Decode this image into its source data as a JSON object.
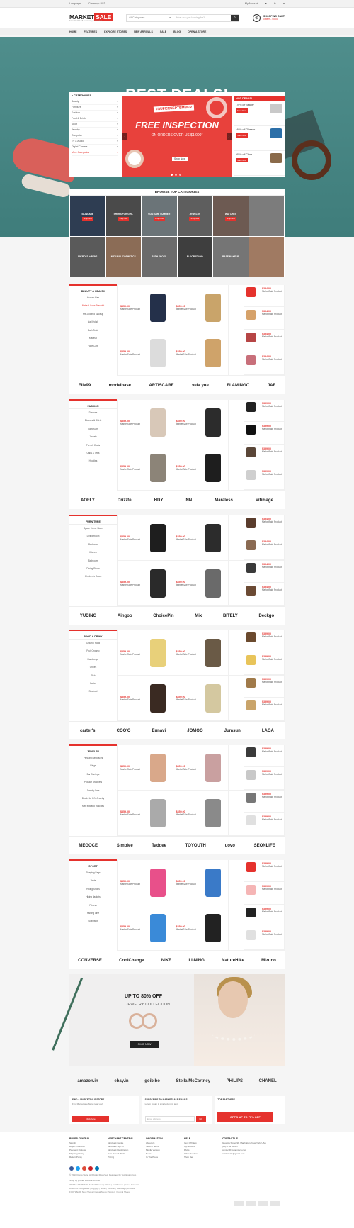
{
  "topbar": {
    "language": "Language:",
    "currency": "Currency: USD",
    "account": "My Account"
  },
  "header": {
    "logo_a": "MARKET",
    "logo_b": "SALE",
    "tagline": "Save 20-30% off on orders your product",
    "search_cat": "All Categories",
    "search_placeholder": "What are you looking for?",
    "cart_title": "SHOPPING CART",
    "cart_sub": "0 item - $0.00"
  },
  "nav": [
    "HOME",
    "FEATURES",
    "EXPLORE STORES",
    "NEW ARRIVALS",
    "SALE",
    "BLOG",
    "OPEN A STORE"
  ],
  "hero": {
    "title": "BEST DEALS!",
    "button": "SUPER SEPTEMBER"
  },
  "categories": {
    "heading": "CATEGORIES",
    "items": [
      "Beauty",
      "Furniture",
      "Fashion",
      "Food & Drink",
      "Sport",
      "Jewelry",
      "Computer",
      "TV & Audio",
      "Digital Camera",
      "More Categories"
    ]
  },
  "slide": {
    "tag": "#SUPERSEPTEMBER",
    "title": "FREE INSPECTION",
    "sub": "ON ORDERS OVER US $1,000*",
    "button": "Shop Now"
  },
  "hot": {
    "heading": "HOT DEALS!",
    "items": [
      {
        "text": "-70% off Beauty",
        "btn": "Shop Now",
        "color": "#c9c9c9"
      },
      {
        "text": "-40% off Glasses",
        "btn": "Shop Now",
        "color": "#2c6fa8"
      },
      {
        "text": "-65% off Chair",
        "btn": "Shop Now",
        "color": "#8a6a4a"
      }
    ]
  },
  "browse": {
    "heading": "BROWSE TOP CATEGORIES",
    "tiles": [
      {
        "label": "SKINCARE",
        "btn": "Shop Now",
        "color": "#2e3d52"
      },
      {
        "label": "SHOES FOR GIRL",
        "btn": "Shop Now",
        "color": "#4a4a4a"
      },
      {
        "label": "COSTUME SUMMER",
        "btn": "Shop Now",
        "color": "#6b7478"
      },
      {
        "label": "JEWELRY",
        "btn": "Shop Now",
        "color": "#5e5e5e"
      },
      {
        "label": "WATCHES",
        "btn": "Shop Now",
        "color": "#6d5a52"
      },
      {
        "label": "",
        "btn": "",
        "color": "#7c7c7c"
      },
      {
        "label": "MICROSD + PENS",
        "btn": "",
        "color": "#5a5a5a"
      },
      {
        "label": "NATURAL COSMETICS",
        "btn": "",
        "color": "#8b6c56"
      },
      {
        "label": "BATH SHOES",
        "btn": "",
        "color": "#6b6b6b"
      },
      {
        "label": "FLOOR STAND",
        "btn": "",
        "color": "#3e3e3e"
      },
      {
        "label": "BASE MAKEUP",
        "btn": "",
        "color": "#757575"
      },
      {
        "label": "",
        "btn": "",
        "color": "#a07a62"
      }
    ]
  },
  "sections": [
    {
      "title": "BEAUTY & HEALTH",
      "subs": [
        "Human Hair",
        "Natural Color Bracelet",
        "Pre-Colored Makeup",
        "Nail Polish",
        "Bath Tools",
        "Makeup",
        "Face Care"
      ],
      "active": 1,
      "price": "$359.00",
      "name": "MarketSale Product",
      "colors": [
        "#24304a",
        "#c9a46a",
        "#dcdcdc",
        "#cfa36a"
      ],
      "side_price": "$354.00",
      "side_colors": [
        "#e5322d",
        "#d6a26a",
        "#b64545",
        "#c86f7a"
      ],
      "brands": [
        "Elle99",
        "modelbase",
        "ARTISCARE",
        "vela.yue",
        "FLAMINGO",
        "JAF"
      ]
    },
    {
      "title": "FASHION",
      "subs": [
        "Dresses",
        "Blouses & Shirts",
        "Jumpsuits",
        "Jackets",
        "French Coats",
        "Caps & Tees",
        "Hoodies"
      ],
      "active": -1,
      "price": "$359.00",
      "name": "MarketSale Product",
      "colors": [
        "#d8c8b8",
        "#2c2c2c",
        "#8c8478",
        "#1e1e1e"
      ],
      "side_price": "$359.00",
      "side_colors": [
        "#222",
        "#111",
        "#5a4638",
        "#cfcfcf"
      ],
      "brands": [
        "AOFLY",
        "Drizzte",
        "HDY",
        "NN",
        "Maraless",
        "Vifimage"
      ]
    },
    {
      "title": "FURNITURE",
      "subs": [
        "Space Home Store",
        "Living Room",
        "Bedroom",
        "Kitchen",
        "Bathroom",
        "Dining Room",
        "Children's Room"
      ],
      "active": -1,
      "price": "$359.00",
      "name": "MarketSale Product",
      "colors": [
        "#1e1e1e",
        "#2c2c2c",
        "#2a2a2a",
        "#6a6a6a"
      ],
      "side_price": "$354.00",
      "side_colors": [
        "#5a3c2c",
        "#8a6a52",
        "#3a3a3a",
        "#6b4a34"
      ],
      "brands": [
        "YUDING",
        "Aingoo",
        "ChoicePin",
        "Mix",
        "BITELY",
        "Deckgo"
      ]
    },
    {
      "title": "FOOD & DRINK",
      "subs": [
        "Organic Food",
        "Fruit Organic",
        "Hamburger",
        "Chilies",
        "Fish",
        "Butter",
        "Seafood"
      ],
      "active": -1,
      "price": "$359.00",
      "name": "MarketSale Product",
      "colors": [
        "#e8d07a",
        "#6a5a46",
        "#3a2a22",
        "#d4c8a0"
      ],
      "side_price": "$359.00",
      "side_colors": [
        "#6b4a2e",
        "#e8c45a",
        "#a07a4a",
        "#c9a46a"
      ],
      "brands": [
        "carter's",
        "COO'O",
        "Eunavi",
        "JOMOO",
        "Jumsun",
        "LAOA"
      ]
    },
    {
      "title": "JEWELRY",
      "subs": [
        "Pendant Necklaces",
        "Rings",
        "Ear Earrings",
        "Popular Bracelets",
        "Jewelry Sets",
        "Beads for DIY Jewelry",
        "Men's Brand Watches"
      ],
      "active": -1,
      "price": "$359.00",
      "name": "MarketSale Product",
      "colors": [
        "#d9a88a",
        "#c9a0a0",
        "#aaaaaa",
        "#8a8a8a"
      ],
      "side_price": "$359.00",
      "side_colors": [
        "#3a3a3a",
        "#c8c8c8",
        "#777",
        "#e0e0e0"
      ],
      "brands": [
        "MEGOCE",
        "Simplee",
        "Taddee",
        "TOYOUTH",
        "uovo",
        "SEONLIFE"
      ]
    },
    {
      "title": "SPORT",
      "subs": [
        "Sleeping Bags",
        "Tents",
        "Hiking Shoes",
        "Hiking Jackets",
        "Fitness",
        "Fishing Line",
        "Swimsuit"
      ],
      "active": -1,
      "price": "$359.00",
      "name": "MarketSale Product",
      "colors": [
        "#e8508a",
        "#3a7ac8",
        "#3a8ad8",
        "#222"
      ],
      "side_price": "$359.00",
      "side_colors": [
        "#e5322d",
        "#f5b5b5",
        "#222",
        "#e0e0e0"
      ],
      "brands": [
        "CONVERSE",
        "CoolChange",
        "NIKE",
        "LI-NING",
        "NatureHike",
        "Mizuno"
      ]
    }
  ],
  "promo": {
    "title": "UP TO 80% OFF",
    "sub": "JEWELRY COLLECTION",
    "button": "SHOP NOW"
  },
  "partners": [
    "amazon.in",
    "ebay.in",
    "goibibo",
    "Stella McCartney",
    "PHILIPS",
    "CHANEL"
  ],
  "boxes": [
    {
      "title": "FIND A MARKETSALE STORE",
      "sub": "Find MarketSale Store near you!",
      "btn": "Click here"
    },
    {
      "title": "SUBSCRIBE TO MARKETSALE EMAILS",
      "sub": "Lorem ipsum is simply dummy text",
      "input": "Email address",
      "btn": "GO"
    },
    {
      "title": "TOP PARTNERS",
      "oppo": "OPPO  UP TO 70% OFF"
    }
  ],
  "footer": {
    "cols": [
      {
        "h": "BUYER CENTRAL",
        "items": [
          "Sign In",
          "Buyer Protection",
          "Payment Options",
          "Shipping Policy",
          "Return Policy"
        ]
      },
      {
        "h": "MERCHANT CENTRAL",
        "items": [
          "Merchant Centre",
          "Merchant Sign In",
          "Merchant Registration",
          "How Does It Work",
          "Pricing"
        ]
      },
      {
        "h": "INFORMATION",
        "items": [
          "About Us",
          "Search Terms",
          "Mobile Version",
          "News",
          "In The Press"
        ]
      },
      {
        "h": "HELP",
        "items": [
          "Item Off Help",
          "My Account",
          "FAQs",
          "Other Services",
          "Shop Ben"
        ]
      }
    ],
    "contact_h": "CONTACT US",
    "contact": [
      "Georgia Street 99, Manhattan, New York, USA",
      "(+0) 8 89 46 987",
      "contact@magentech.com",
      "marketsale@gmail.com"
    ],
    "copyright": "© 2017 Demo Store. All Rights Reserved. Designed by TopDesign.com",
    "shop": "Shop by phone: 1-800-950-2238",
    "tags": [
      "WORKS & TABLETS: Android Phones | Tablets | Cell Phones | Cases & Covers",
      "FASHION: Sunglasses | Luggage | Shoes | Watches | Handbags | Dresses",
      "FOOTWEAR: Sport Shoes | Casual Shoes | Slippers | Formal Shoes"
    ]
  }
}
